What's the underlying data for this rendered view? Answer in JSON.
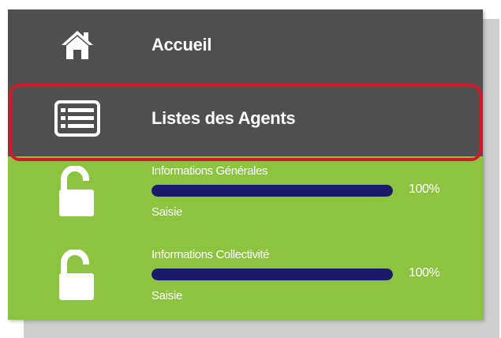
{
  "nav": {
    "items": [
      {
        "label": "Accueil",
        "icon": "home-icon"
      },
      {
        "label": "Listes des Agents",
        "icon": "list-icon"
      }
    ],
    "highlighted_item": "Listes des Agents"
  },
  "sections": [
    {
      "title": "Informations Générales",
      "progress": 100,
      "progress_label": "100%",
      "status": "Saisie",
      "icon": "unlock-icon"
    },
    {
      "title": "Informations Collectivité",
      "progress": 100,
      "progress_label": "100%",
      "status": "Saisie",
      "icon": "unlock-icon"
    }
  ],
  "colors": {
    "nav_background": "#4f4f4f",
    "section_background": "#8cc43f",
    "progress_fill": "#1c1b6b",
    "highlight_border": "#d3182a",
    "text": "#ffffff"
  }
}
